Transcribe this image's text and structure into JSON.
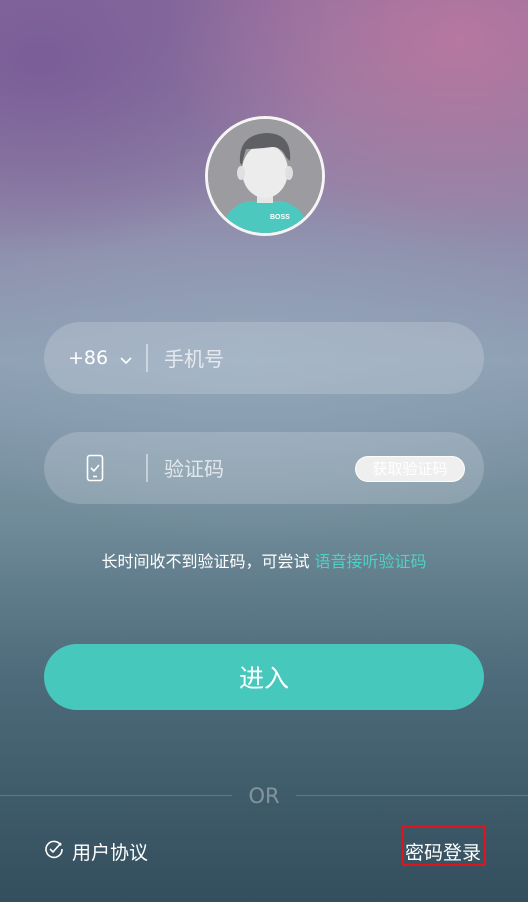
{
  "avatar": {
    "badge_text": "BOSS"
  },
  "phone_field": {
    "country_code": "+86",
    "placeholder": "手机号"
  },
  "code_field": {
    "placeholder": "验证码",
    "get_code_label": "获取验证码"
  },
  "hint": {
    "text": "长时间收不到验证码，可尝试 ",
    "link": "语音接听验证码"
  },
  "enter_button": "进入",
  "or_label": "OR",
  "agreement_label": "用户协议",
  "password_login_label": "密码登录",
  "colors": {
    "accent": "#46c8bd",
    "link": "#4fd0c4",
    "highlight": "#e0141a"
  }
}
